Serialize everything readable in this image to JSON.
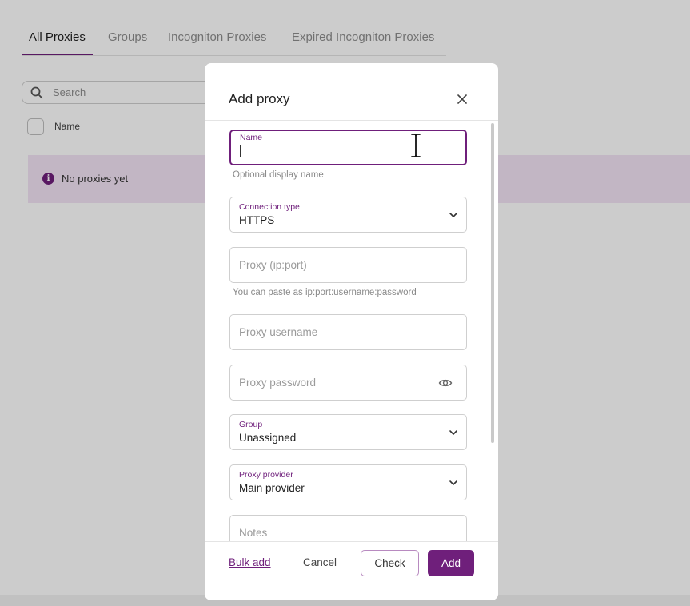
{
  "background": {
    "tabs": [
      {
        "label": "All Proxies",
        "active": true
      },
      {
        "label": "Groups",
        "active": false
      },
      {
        "label": "Incogniton Proxies",
        "active": false
      },
      {
        "label": "Expired Incogniton Proxies",
        "active": false
      }
    ],
    "search": {
      "placeholder": "Search",
      "icon": "search-icon"
    },
    "table": {
      "columns": [
        "Name"
      ]
    },
    "empty_state": {
      "text": "No proxies yet",
      "icon": "info-icon"
    }
  },
  "modal": {
    "title": "Add proxy",
    "close_icon": "close-icon",
    "fields": {
      "name": {
        "label": "Name",
        "value": "",
        "helper": "Optional display name",
        "focused": true
      },
      "connection_type": {
        "label": "Connection type",
        "value": "HTTPS",
        "icon": "chevron-down-icon"
      },
      "proxy": {
        "placeholder": "Proxy (ip:port)",
        "helper": "You can paste as ip:port:username:password"
      },
      "username": {
        "placeholder": "Proxy username"
      },
      "password": {
        "placeholder": "Proxy password",
        "icon": "eye-icon"
      },
      "group": {
        "label": "Group",
        "value": "Unassigned",
        "icon": "chevron-down-icon"
      },
      "provider": {
        "label": "Proxy provider",
        "value": "Main provider",
        "icon": "chevron-down-icon"
      },
      "notes": {
        "placeholder": "Notes"
      }
    },
    "footer": {
      "bulk_add": "Bulk add",
      "cancel": "Cancel",
      "check": "Check",
      "add": "Add"
    }
  },
  "colors": {
    "accent": "#6f1f7b",
    "banner_bg": "#f3e4f5",
    "overlay": "rgba(0,0,0,0.2)"
  }
}
